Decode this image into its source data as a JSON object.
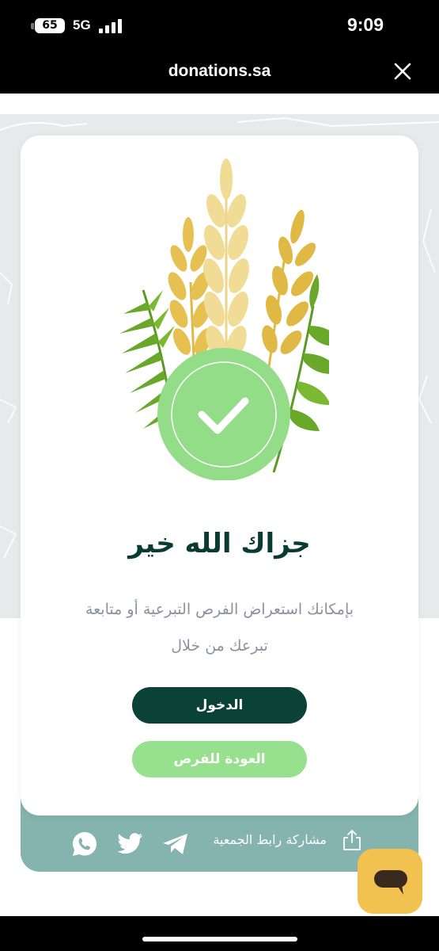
{
  "status_bar": {
    "battery": "65",
    "network": "5G",
    "time": "9:09"
  },
  "browser": {
    "url": "donations.sa",
    "close_icon": "close-icon"
  },
  "card": {
    "illustration": "wheat-and-palm-leaves-with-check-badge",
    "title": "جزاك الله خير",
    "message_line1": "بإمكانك استعراض الفرص التبرعية أو متابعة",
    "message_line2": "تبرعك من خلال",
    "login_button": "الدخول",
    "back_button": "العودة للفرص"
  },
  "share": {
    "label": "مشاركة رابط الجمعية",
    "icons": [
      "share-icon",
      "telegram-icon",
      "twitter-icon",
      "whatsapp-icon"
    ]
  },
  "chat": {
    "icon": "chat-bubble-icon"
  },
  "colors": {
    "primary_dark": "#0b4237",
    "accent_green": "#97e08d",
    "share_bar": "#84b4ad",
    "chat_button": "#f2c250",
    "title_text": "#0a3b33"
  }
}
